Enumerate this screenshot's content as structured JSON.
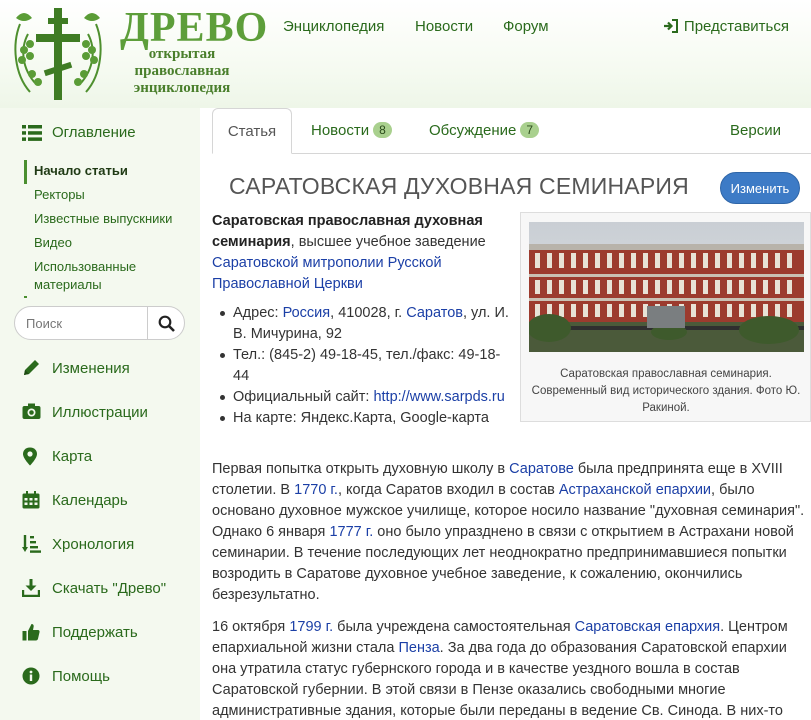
{
  "logo": {
    "title": "ДРЕВО",
    "subtitle": "открытая православная энциклопедия"
  },
  "topnav": {
    "items": [
      "Энциклопедия",
      "Новости",
      "Форум"
    ],
    "login": "Представиться"
  },
  "sidebar": {
    "toc_title": "Оглавление",
    "toc": [
      "Начало статьи",
      "Ректоры",
      "Известные выпускники",
      "Видео",
      "Использованные материалы"
    ],
    "search_placeholder": "Поиск",
    "menu": [
      "Изменения",
      "Иллюстрации",
      "Карта",
      "Календарь",
      "Хронология",
      "Скачать \"Древо\"",
      "Поддержать",
      "Помощь"
    ]
  },
  "tabs": {
    "article": "Статья",
    "news": "Новости",
    "news_count": "8",
    "discussion": "Обсуждение",
    "discussion_count": "7",
    "versions": "Версии"
  },
  "article": {
    "title": "САРАТОВСКАЯ ДУХОВНАЯ СЕМИНАРИЯ",
    "edit_button": "Изменить",
    "lead_bold": "Саратовская православная духовная семинария",
    "lead_text": ", высшее учебное заведение ",
    "lead_link": "Саратовской митрополии Русской Православной Церкви",
    "address_label": "Адрес: ",
    "address_country": "Россия",
    "address_mid": ", 410028, г. ",
    "address_city": "Саратов",
    "address_street": ", ул. И. В. Мичурина, 92",
    "phone": "Тел.: (845-2) 49-18-45, тел./факс: 49-18-44",
    "site_label": "Официальный сайт: ",
    "site_url": "http://www.sarpds.ru",
    "map_label": "На карте: Яндекс.Карта, Google-карта",
    "photo_caption": "Саратовская православная семинария. Современный вид исторического здания. Фото Ю. Ракиной."
  },
  "paragraph1": {
    "t1": "Первая попытка открыть духовную школу в ",
    "l1": "Саратове",
    "t2": " была предпринята еще в XVIII столетии. В ",
    "l2": "1770 г.",
    "t3": ", когда Саратов входил в состав ",
    "l3": "Астраханской епархии",
    "t4": ", было основано духовное мужское училище, которое носило название \"духовная семинария\". Однако 6 января ",
    "l4": "1777 г.",
    "t5": " оно было упразднено в связи с открытием в Астрахани новой семинарии. В течение последующих лет неоднократно предпринимавшиеся попытки возродить в Саратове духовное учебное заведение, к сожалению, окончились безрезультатно."
  },
  "paragraph2": {
    "t1": "16 октября ",
    "l1": "1799 г.",
    "t2": " была учреждена самостоятельная ",
    "l2": "Саратовская епархия",
    "t3": ". Центром епархиальной жизни стала ",
    "l3": "Пенза",
    "t4": ". За два года до образования Саратовской епархии она утратила статус губернского города и в качестве уездного вошла в состав Саратовской губернии. В этой связи в Пензе оказались свободными многие административные здания, которые были переданы в ведение Св. Синода. В них-то"
  }
}
